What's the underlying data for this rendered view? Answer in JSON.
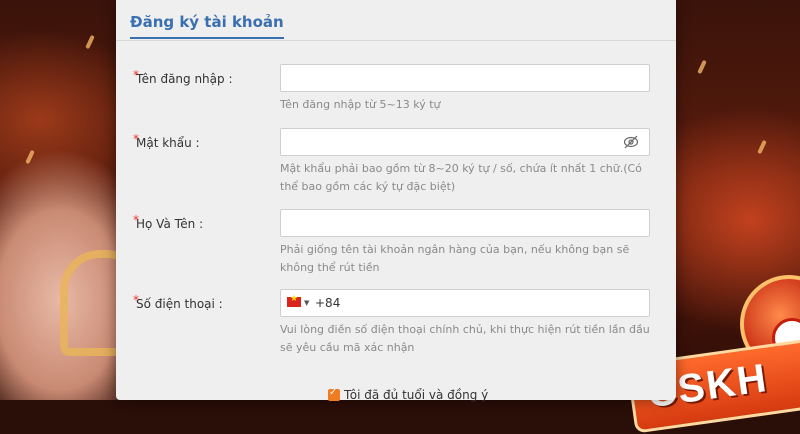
{
  "form": {
    "title": "Đăng ký tài khoản",
    "required_marker": "*",
    "fields": [
      {
        "label": "Tên đăng nhập :",
        "value": "",
        "hint": "Tên đăng nhập từ 5~13 ký tự"
      },
      {
        "label": "Mật khẩu :",
        "value": "",
        "hint": "Mật khẩu phải bao gồm từ 8~20 ký tự / số, chứa ít nhất 1 chữ.(Có thể bao gồm các ký tự đặc biệt)"
      },
      {
        "label": "Họ Và Tên :",
        "value": "",
        "hint": "Phải giống tên tài khoản ngân hàng của bạn, nếu không bạn sẽ không thể rút tiền"
      },
      {
        "label": "Số điện thoại :",
        "country_code": "+84",
        "flag": "vietnam-flag-icon",
        "hint": "Vui lòng điền số điện thoại chính chủ, khi thực hiện rút tiền lần đầu sẽ yêu cầu mã xác nhận"
      }
    ],
    "agree_label": "Tôi đã đủ tuổi và đồng ý",
    "agree_checked": true
  },
  "background": {
    "support_label": "CSKH",
    "accent_color": "#3a6fb0",
    "required_color": "#e33333",
    "checkbox_color": "#f07c22"
  }
}
